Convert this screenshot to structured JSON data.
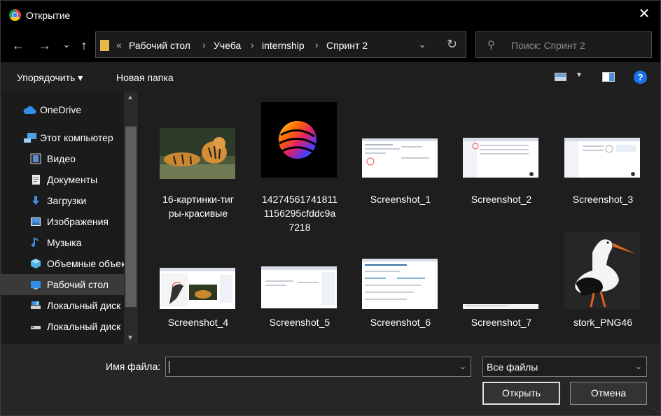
{
  "window": {
    "title": "Открытие",
    "close_icon": "✕"
  },
  "nav": {
    "back": "←",
    "forward": "→",
    "recent": "⌄",
    "up": "↑",
    "breadcrumb_overflow": "«",
    "breadcrumbs": [
      "Рабочий стол",
      "Учеба",
      "internship",
      "Спринт 2"
    ],
    "separator": "›",
    "search_placeholder": "Поиск: Спринт 2"
  },
  "toolbar": {
    "organize": "Упорядочить ▾",
    "new_folder": "Новая папка",
    "help": "?"
  },
  "sidebar": {
    "items": [
      {
        "label": "OneDrive",
        "icon": "cloud-icon"
      },
      {
        "label": "Этот компьютер",
        "icon": "computer-icon"
      },
      {
        "label": "Видео",
        "icon": "video-icon"
      },
      {
        "label": "Документы",
        "icon": "documents-icon"
      },
      {
        "label": "Загрузки",
        "icon": "download-icon"
      },
      {
        "label": "Изображения",
        "icon": "pictures-icon"
      },
      {
        "label": "Музыка",
        "icon": "music-icon"
      },
      {
        "label": "Объемные объекты",
        "icon": "3d-objects-icon"
      },
      {
        "label": "Рабочий стол",
        "icon": "desktop-icon",
        "selected": true
      },
      {
        "label": "Локальный диск (C:)",
        "icon": "drive-icon"
      },
      {
        "label": "Локальный диск (D:)",
        "icon": "drive-icon"
      }
    ]
  },
  "files": [
    {
      "name": "16-картинки-тиг\nры-красивые",
      "thumb": "tigers"
    },
    {
      "name": "14274561741811\n1156295cfddc9a\n7218",
      "thumb": "sphere"
    },
    {
      "name": "Screenshot_1",
      "thumb": "screenshot"
    },
    {
      "name": "Screenshot_2",
      "thumb": "screenshot"
    },
    {
      "name": "Screenshot_3",
      "thumb": "screenshot"
    },
    {
      "name": "Screenshot_4",
      "thumb": "screenshot-stork"
    },
    {
      "name": "Screenshot_5",
      "thumb": "screenshot"
    },
    {
      "name": "Screenshot_6",
      "thumb": "screenshot"
    },
    {
      "name": "Screenshot_7",
      "thumb": "screenshot-strip"
    },
    {
      "name": "stork_PNG46",
      "thumb": "stork"
    }
  ],
  "footer": {
    "filename_label": "Имя файла:",
    "filename_value": "",
    "filetype_value": "Все файлы",
    "open_button": "Открыть",
    "cancel_button": "Отмена"
  }
}
